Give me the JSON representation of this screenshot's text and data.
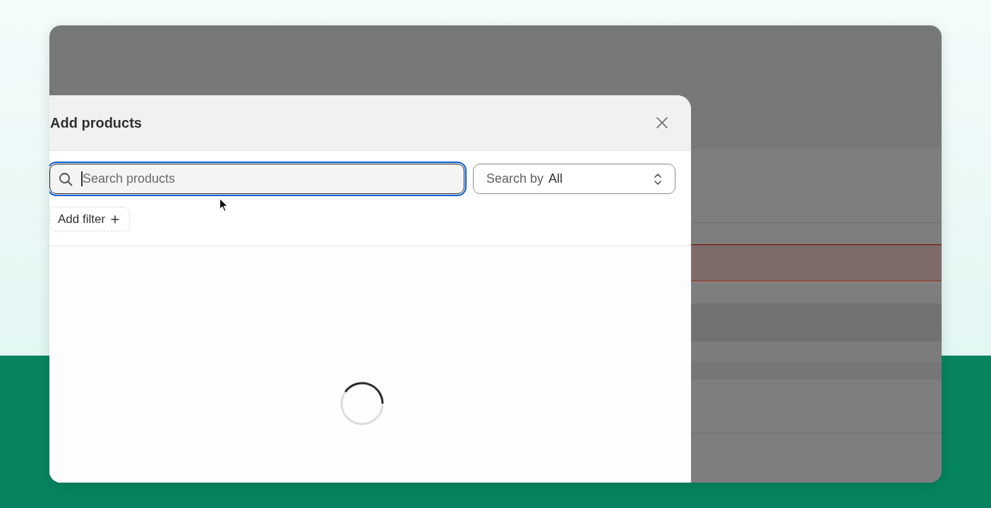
{
  "dialog": {
    "title": "Add products",
    "search": {
      "placeholder": "Search products",
      "focused": true
    },
    "search_by": {
      "label": "Search by",
      "value": "All"
    },
    "filter_button": {
      "label": "Add filter"
    },
    "loading": true
  }
}
